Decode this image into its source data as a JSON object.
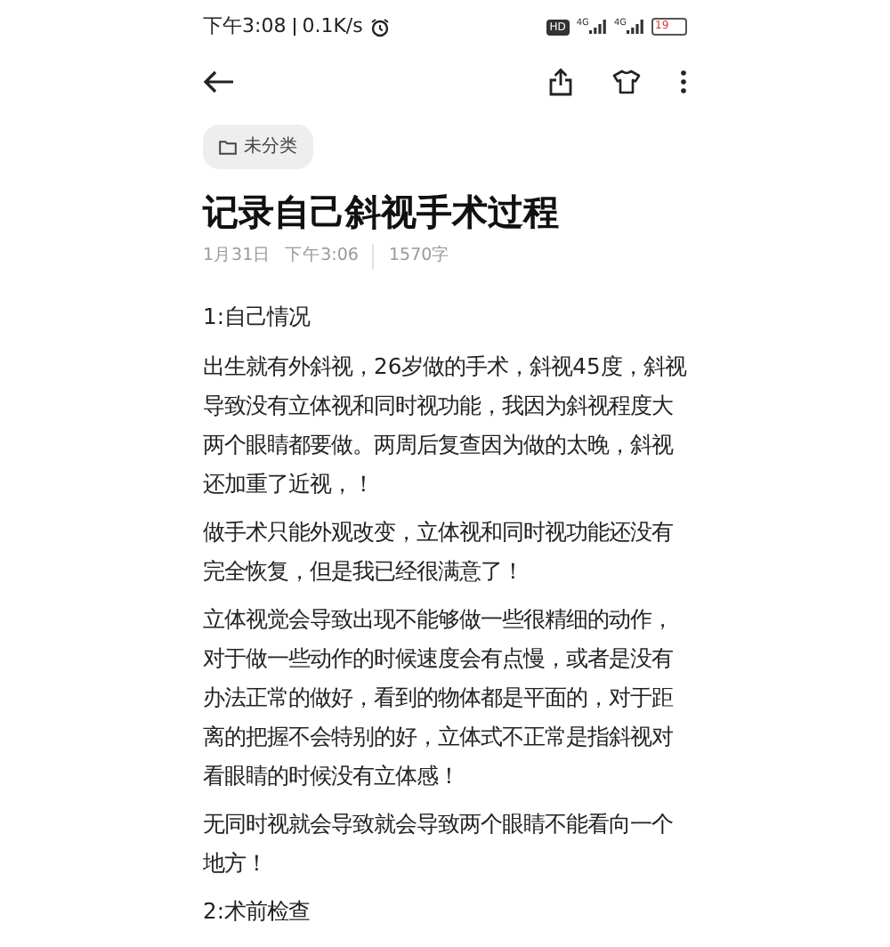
{
  "status_bar": {
    "time": "下午3:08",
    "speed": "0.1K/s",
    "hd": "HD",
    "signals": [
      {
        "network": "4G"
      },
      {
        "network": "4G"
      }
    ],
    "battery": "19"
  },
  "category_chip": {
    "label": "未分类"
  },
  "note": {
    "title": "记录自己斜视手术过程",
    "date": "1月31日",
    "time": "下午3:06",
    "word_count": "1570字",
    "paragraphs": [
      {
        "kind": "heading",
        "text": "1:自己情况"
      },
      {
        "kind": "body",
        "text": "出生就有外斜视，26岁做的手术，斜视45度，斜视导致没有立体视和同时视功能，我因为斜视程度大两个眼睛都要做。两周后复查因为做的太晚，斜视还加重了近视，！"
      },
      {
        "kind": "body",
        "text": "做手术只能外观改变，立体视和同时视功能还没有完全恢复，但是我已经很满意了！"
      },
      {
        "kind": "body",
        "text": "立体视觉会导致出现不能够做一些很精细的动作，对于做一些动作的时候速度会有点慢，或者是没有办法正常的做好，看到的物体都是平面的，对于距离的把握不会特别的好，立体式不正常是指斜视对看眼睛的时候没有立体感！"
      },
      {
        "kind": "body",
        "text": "无同时视就会导致就会导致两个眼睛不能看向一个地方！"
      },
      {
        "kind": "heading",
        "text": "2:术前检查"
      }
    ]
  }
}
